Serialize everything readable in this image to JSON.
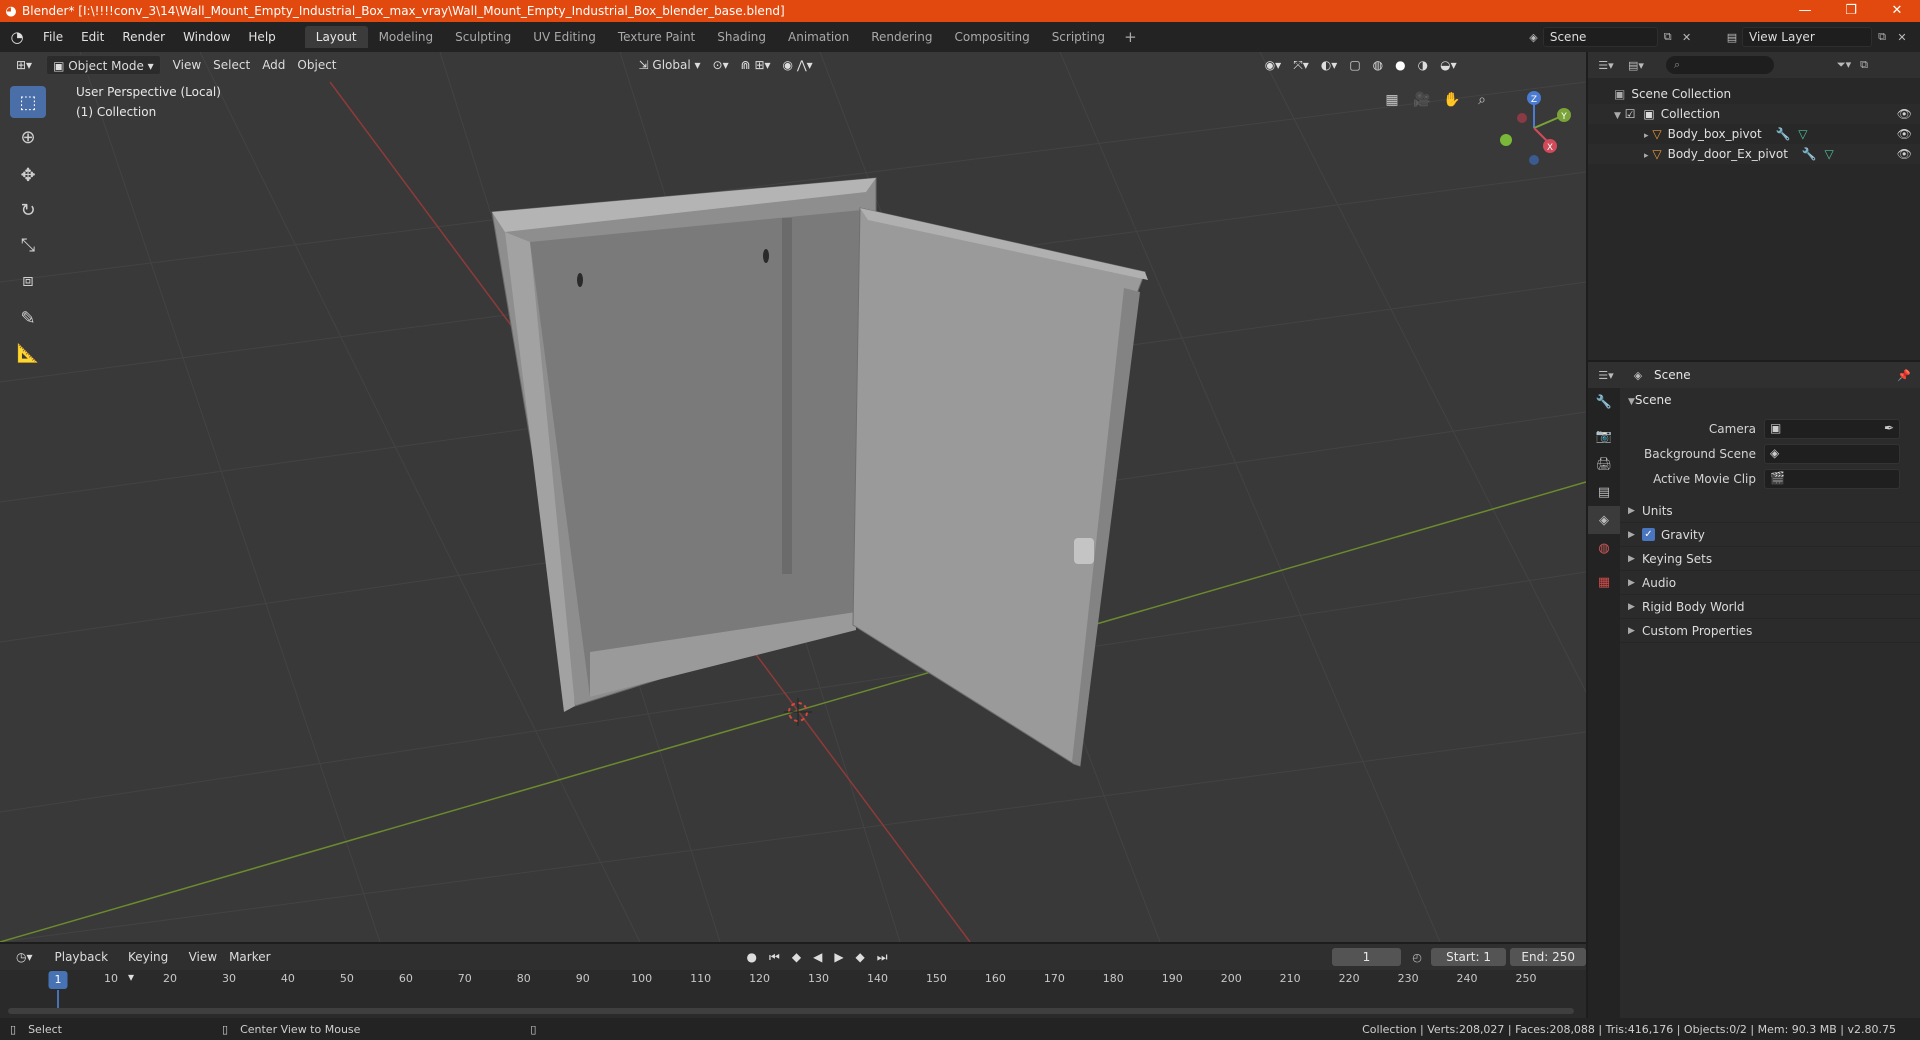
{
  "window": {
    "title": "Blender* [I:\\!!!!conv_3\\14\\Wall_Mount_Empty_Industrial_Box_max_vray\\Wall_Mount_Empty_Industrial_Box_blender_base.blend]",
    "controls": [
      "—",
      "❐",
      "✕"
    ]
  },
  "menubar": {
    "menus": [
      "File",
      "Edit",
      "Render",
      "Window",
      "Help"
    ],
    "workspaces": [
      "Layout",
      "Modeling",
      "Sculpting",
      "UV Editing",
      "Texture Paint",
      "Shading",
      "Animation",
      "Rendering",
      "Compositing",
      "Scripting"
    ],
    "active_workspace": "Layout",
    "add_workspace": "+",
    "scene": "Scene",
    "view_layer": "View Layer"
  },
  "viewport": {
    "mode": "Object Mode",
    "menus": [
      "View",
      "Select",
      "Add",
      "Object"
    ],
    "orientation": "Global",
    "info_line1": "User Perspective (Local)",
    "info_line2": "(1) Collection",
    "gizmo_axes": [
      "X",
      "Y",
      "Z"
    ]
  },
  "outliner": {
    "search_placeholder": "",
    "root": "Scene Collection",
    "collection": "Collection",
    "objects": [
      "Body_box_pivot",
      "Body_door_Ex_pivot"
    ]
  },
  "properties": {
    "context": "Scene",
    "panel": "Scene",
    "fields": [
      {
        "label": "Camera"
      },
      {
        "label": "Background Scene"
      },
      {
        "label": "Active Movie Clip"
      }
    ],
    "subpanels": [
      {
        "label": "Units",
        "checkbox": false
      },
      {
        "label": "Gravity",
        "checkbox": true
      },
      {
        "label": "Keying Sets",
        "checkbox": false
      },
      {
        "label": "Audio",
        "checkbox": false
      },
      {
        "label": "Rigid Body World",
        "checkbox": false
      },
      {
        "label": "Custom Properties",
        "checkbox": false
      }
    ]
  },
  "timeline": {
    "menus": [
      "Playback",
      "Keying",
      "View",
      "Marker"
    ],
    "current_frame": "1",
    "start_label": "Start:",
    "start": "1",
    "end_label": "End:",
    "end": "250",
    "ticks": [
      "1",
      "10",
      "20",
      "30",
      "40",
      "50",
      "60",
      "70",
      "80",
      "90",
      "100",
      "110",
      "120",
      "130",
      "140",
      "150",
      "160",
      "170",
      "180",
      "190",
      "200",
      "210",
      "220",
      "230",
      "240",
      "250"
    ]
  },
  "statusbar": {
    "left_action": "Select",
    "mid_action": "Center View to Mouse",
    "stats": "Collection | Verts:208,027 | Faces:208,088 | Tris:416,176 | Objects:0/2 | Mem: 90.3 MB | v2.80.75"
  }
}
